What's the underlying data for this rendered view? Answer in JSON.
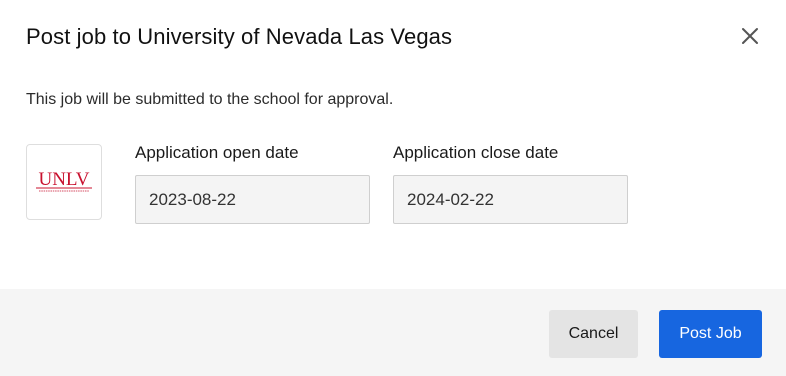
{
  "dialog": {
    "title": "Post job to University of Nevada Las Vegas",
    "description": "This job will be submitted to the school for approval.",
    "close_icon": "close-icon"
  },
  "school": {
    "logo_text": "UNLV",
    "logo_tagline": "UNIVERSITY OF NEVADA LAS VEGAS",
    "logo_color": "#c8102e"
  },
  "fields": {
    "open_date": {
      "label": "Application open date",
      "value": "2023-08-22"
    },
    "close_date": {
      "label": "Application close date",
      "value": "2024-02-22"
    }
  },
  "footer": {
    "cancel_label": "Cancel",
    "post_label": "Post Job"
  },
  "colors": {
    "primary": "#1766e0",
    "footer_bg": "#f5f5f5",
    "input_bg": "#f4f4f4"
  }
}
